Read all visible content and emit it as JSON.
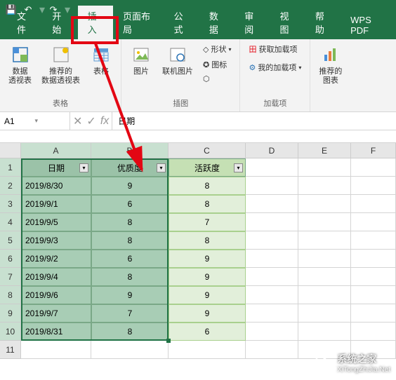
{
  "menu": {
    "tabs": [
      "文件",
      "开始",
      "插入",
      "页面布局",
      "公式",
      "数据",
      "审阅",
      "视图",
      "帮助",
      "WPS PDF"
    ],
    "active_index": 2
  },
  "ribbon": {
    "group1": {
      "pivot": "数据\n透视表",
      "rec_pivot": "推荐的\n数据透视表",
      "table": "表格",
      "label": "表格"
    },
    "group2": {
      "image": "图片",
      "online_image": "联机图片",
      "shapes": "形状",
      "icons": "图标",
      "label": "插图"
    },
    "group3": {
      "get_addons": "获取加载项",
      "my_addons": "我的加载项",
      "label": "加载项"
    },
    "group4": {
      "rec_chart": "推荐的\n图表"
    }
  },
  "formula_bar": {
    "name_box": "A1",
    "fx": "fx",
    "value": "日期"
  },
  "columns": [
    "A",
    "B",
    "C",
    "D",
    "E",
    "F"
  ],
  "headers": {
    "date": "日期",
    "quality": "优质度",
    "activity": "活跃度"
  },
  "rows": [
    {
      "date": "2019/8/30",
      "quality": "9",
      "activity": "8"
    },
    {
      "date": "2019/9/1",
      "quality": "6",
      "activity": "8"
    },
    {
      "date": "2019/9/5",
      "quality": "8",
      "activity": "7"
    },
    {
      "date": "2019/9/3",
      "quality": "8",
      "activity": "8"
    },
    {
      "date": "2019/9/2",
      "quality": "6",
      "activity": "9"
    },
    {
      "date": "2019/9/4",
      "quality": "8",
      "activity": "9"
    },
    {
      "date": "2019/9/6",
      "quality": "9",
      "activity": "9"
    },
    {
      "date": "2019/9/7",
      "quality": "7",
      "activity": "9"
    },
    {
      "date": "2019/8/31",
      "quality": "8",
      "activity": "6"
    }
  ],
  "watermark": {
    "name": "系统之家",
    "url": "XiTongZhiJia.Net"
  }
}
